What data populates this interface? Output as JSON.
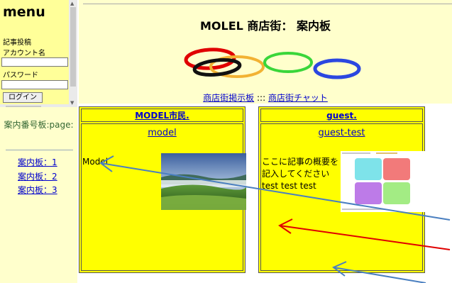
{
  "menu": {
    "title": "menu",
    "post_label": "記事投稿",
    "account_label": "アカウント名",
    "password_label": "パスワード",
    "login_button": "ログイン"
  },
  "sidebar": {
    "annai_label": "案内番号板:page:",
    "boards": [
      "案内板：1",
      "案内板：2",
      "案内板：3"
    ]
  },
  "header": {
    "title": "MOLEL 商店街：  案内板",
    "nav_board": "商店街掲示板",
    "nav_sep": ":::",
    "nav_chat": "商店街チャット"
  },
  "cards": [
    {
      "author": "MODEL市民.",
      "title": "model",
      "summary": "Model",
      "image": "landscape-photo"
    },
    {
      "author": "guest.",
      "title": "guest-test",
      "summary": "ここに記事の概要を記入してください test test test",
      "image": "ui-thumbnail"
    }
  ],
  "colors": {
    "page_bg": "#ffffcc",
    "card_bg": "#ffff00",
    "link": "#0000cc",
    "arrow_blue": "#4a7fc0",
    "arrow_red": "#e00000"
  }
}
